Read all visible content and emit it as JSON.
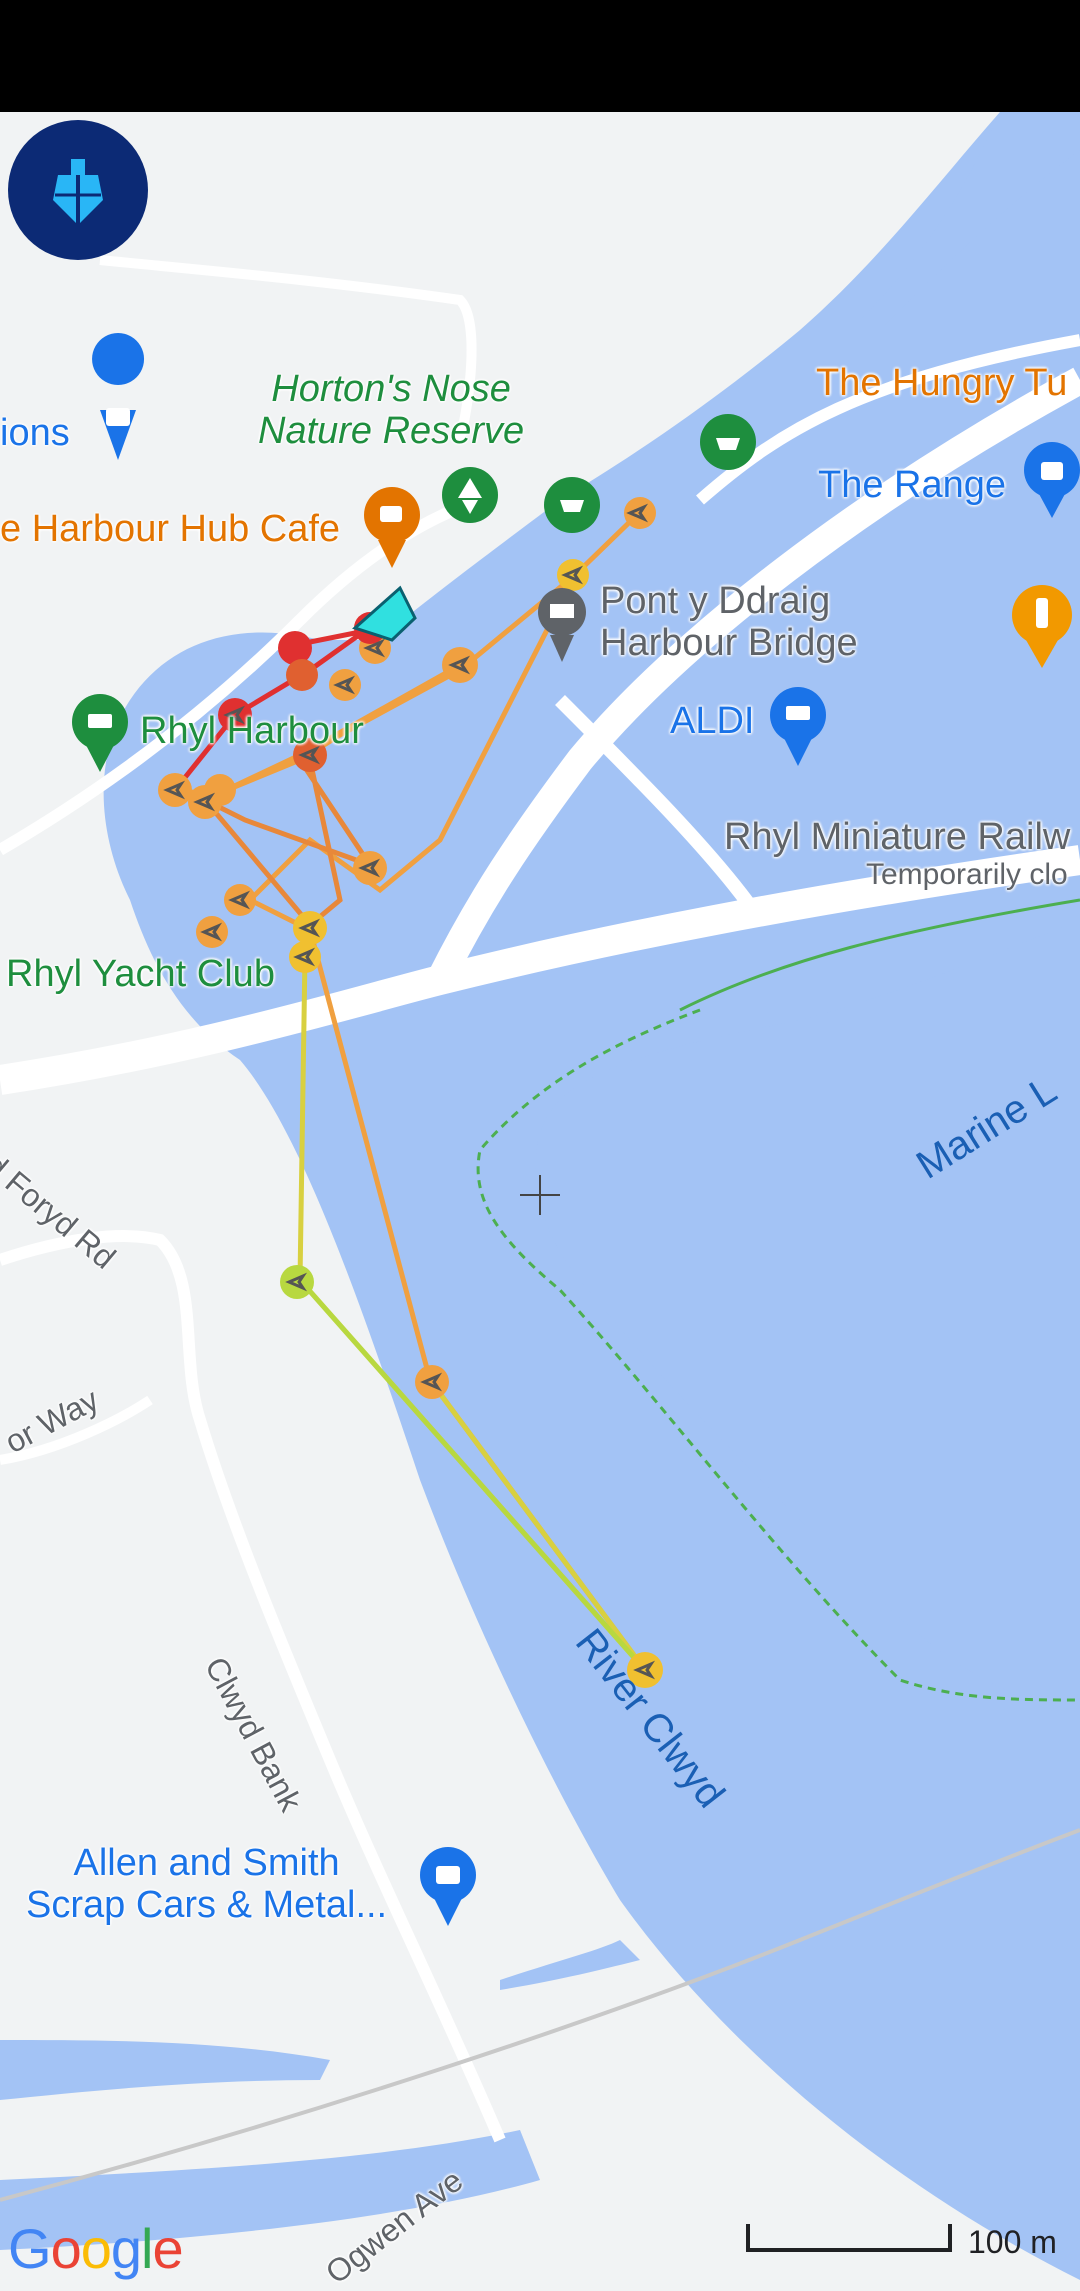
{
  "map": {
    "labels": {
      "nature_reserve": [
        "Horton's Nose",
        "Nature Reserve"
      ],
      "hungry_tummy": "The Hungry Tu",
      "the_range": "The Range",
      "ions": "ions",
      "harbour_hub": "e Harbour Hub Cafe",
      "pont_bridge": [
        "Pont y Ddraig",
        "Harbour Bridge"
      ],
      "aldi": "ALDI",
      "rhyl_harbour": "Rhyl Harbour",
      "rhyl_miniature": "Rhyl Miniature Railw",
      "temporarily_closed": "Temporarily clo",
      "rhyl_yacht": "Rhyl Yacht Club",
      "marine_lake": "Marine L",
      "foryd_rd": "d Foryd Rd",
      "or_way": "or Way",
      "river_clwyd": "River Clwyd",
      "clwyd_bank": "Clwyd Bank",
      "allen_smith": [
        "Allen and Smith",
        "Scrap Cars & Metal..."
      ],
      "ogwen_ave": "Ogwen Ave"
    },
    "scale_label": "100 m",
    "google_logo": "Google",
    "colors": {
      "water": "#a3c3f5",
      "land": "#f1f3f4",
      "road": "#ffffff",
      "track_red": "#e03030",
      "track_orange": "#f0a040",
      "track_yellow": "#f0c030",
      "track_green": "#b8d840",
      "vessel": "#30e0e0"
    },
    "icons": [
      "app-logo-ship-icon",
      "park-icon",
      "shopping-bag-icon",
      "coffee-icon",
      "restaurant-icon",
      "bridge-icon",
      "cart-icon",
      "ferry-icon",
      "crosshair-icon",
      "vessel-icon"
    ]
  }
}
